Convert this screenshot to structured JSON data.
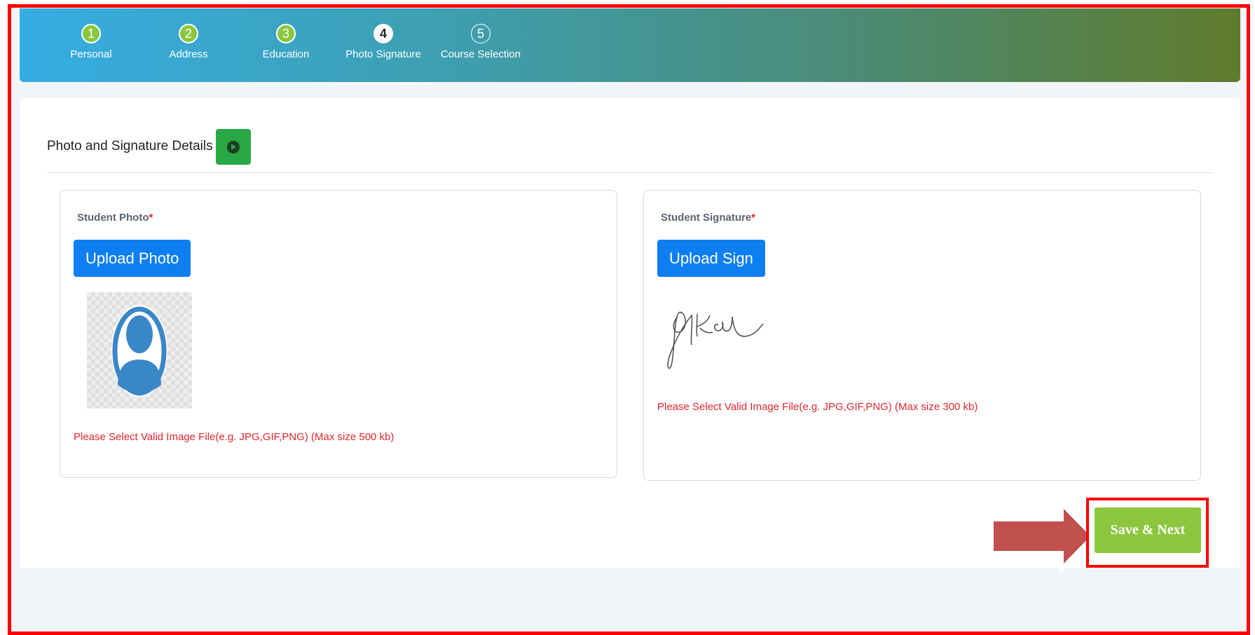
{
  "steps": [
    {
      "num": "1",
      "label": "Personal",
      "state": "done"
    },
    {
      "num": "2",
      "label": "Address",
      "state": "done"
    },
    {
      "num": "3",
      "label": "Education",
      "state": "done"
    },
    {
      "num": "4",
      "label": "Photo Signature",
      "state": "active"
    },
    {
      "num": "5",
      "label": "Course Selection",
      "state": "todo"
    }
  ],
  "section": {
    "title": "Photo and Signature Details"
  },
  "photo": {
    "label": "Student Photo",
    "required": "*",
    "button": "Upload Photo",
    "hint": "Please Select Valid Image File(e.g. JPG,GIF,PNG) (Max size 500 kb)"
  },
  "signature": {
    "label": "Student Signature",
    "required": "*",
    "button": "Upload Sign",
    "hint": "Please Select Valid Image File(e.g. JPG,GIF,PNG) (Max size 300 kb)"
  },
  "actions": {
    "save_next": "Save & Next"
  },
  "colors": {
    "primary_button": "#0d7ff2",
    "save_button": "#8cc63f",
    "error_text": "#e0262b",
    "highlight": "#ff0000",
    "arrow": "#c0504d"
  }
}
